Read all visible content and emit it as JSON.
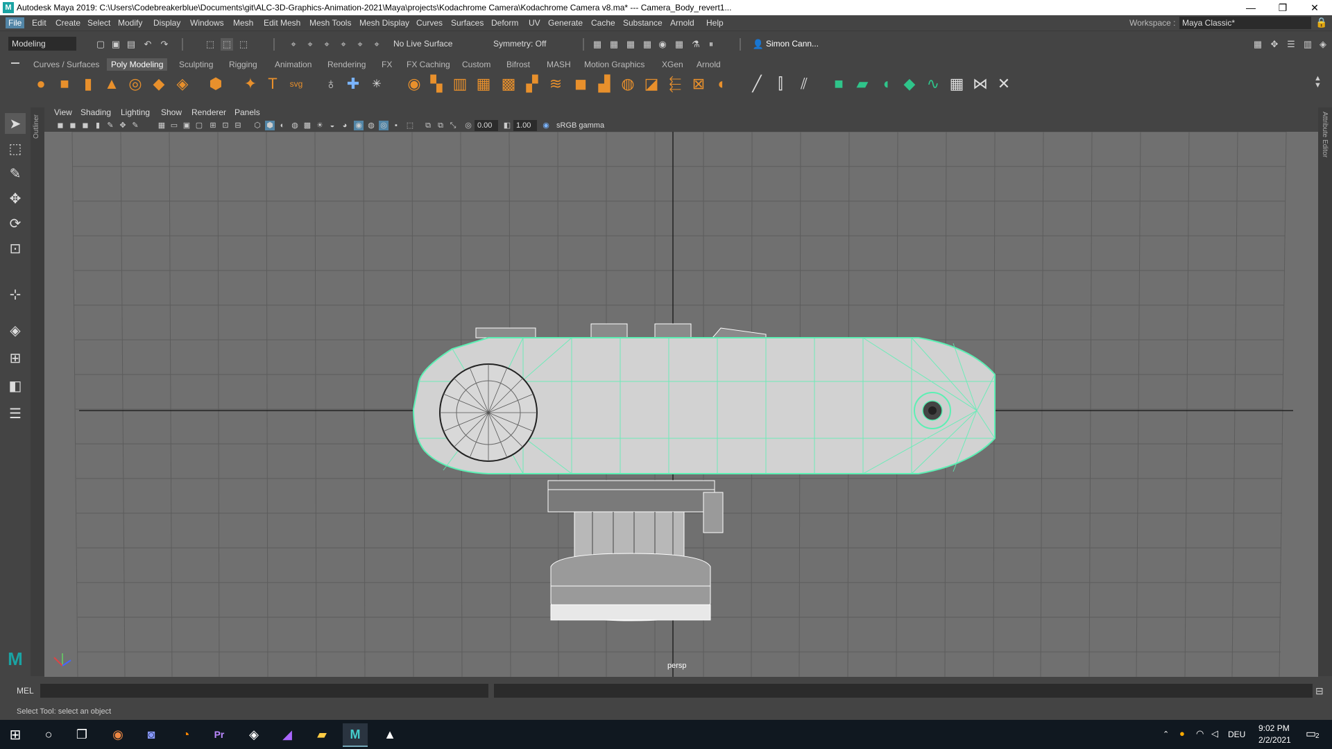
{
  "window": {
    "app_icon": "M",
    "title": "Autodesk Maya 2019: C:\\Users\\Codebreakerblue\\Documents\\git\\ALC-3D-Graphics-Animation-2021\\Maya\\projects\\Kodachrome Camera\\Kodachrome Camera v8.ma*   ---   Camera_Body_revert1...",
    "minimize": "—",
    "maximize": "❐",
    "close": "✕"
  },
  "menubar": {
    "items": [
      "File",
      "Edit",
      "Create",
      "Select",
      "Modify",
      "Display",
      "Windows",
      "Mesh",
      "Edit Mesh",
      "Mesh Tools",
      "Mesh Display",
      "Curves",
      "Surfaces",
      "Deform",
      "UV",
      "Generate",
      "Cache",
      "Substance",
      "Arnold",
      "Help"
    ],
    "workspace_label": "Workspace :",
    "workspace_value": "Maya Classic*"
  },
  "statusline": {
    "mode": "Modeling",
    "live_surface": "No Live Surface",
    "symmetry": "Symmetry: Off",
    "user": "Simon Cann..."
  },
  "shelf": {
    "tabs": [
      "Curves / Surfaces",
      "Poly Modeling",
      "Sculpting",
      "Rigging",
      "Animation",
      "Rendering",
      "FX",
      "FX Caching",
      "Custom",
      "Bifrost",
      "MASH",
      "Motion Graphics",
      "XGen",
      "Arnold"
    ],
    "active_tab": "Poly Modeling"
  },
  "sidebar": {
    "outliner_label": "Outliner",
    "attribute_editor_label": "Attribute Editor"
  },
  "viewport": {
    "menus": [
      "View",
      "Shading",
      "Lighting",
      "Show",
      "Renderer",
      "Panels"
    ],
    "exposure": "0.00",
    "gamma": "1.00",
    "color_space": "sRGB gamma",
    "camera_label": "persp",
    "axis_labels": {
      "x": "x",
      "y": "y",
      "z": "z"
    }
  },
  "commandline": {
    "label": "MEL"
  },
  "helpline": {
    "text": "Select Tool: select an object"
  },
  "taskbar": {
    "language": "DEU",
    "time": "9:02 PM",
    "date": "2/2/2021",
    "notifications": "2"
  },
  "colors": {
    "selection_wire": "#5cf0b4",
    "viewport_bg": "#707070",
    "active_menu": "#5285a6"
  }
}
